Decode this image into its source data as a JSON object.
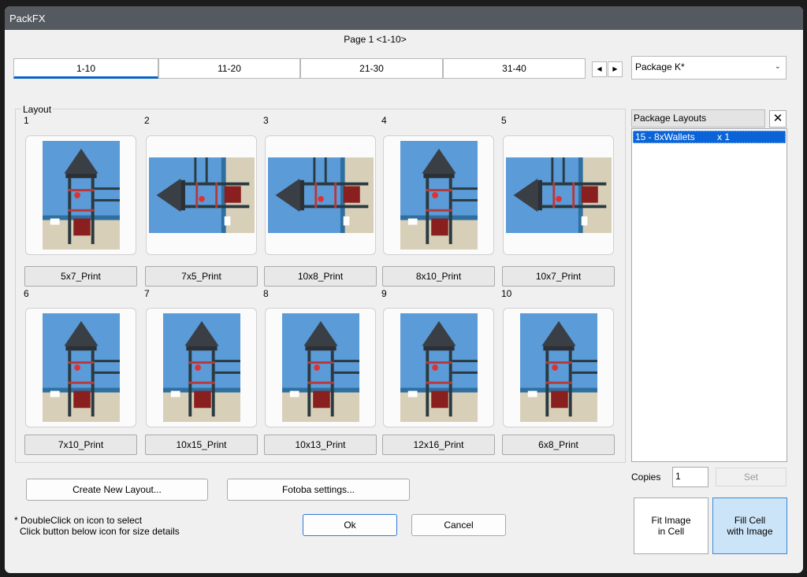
{
  "window": {
    "title": "PackFX"
  },
  "page_label": "Page 1 <1-10>",
  "tabs": [
    {
      "label": "1-10",
      "active": true
    },
    {
      "label": "11-20",
      "active": false
    },
    {
      "label": "21-30",
      "active": false
    },
    {
      "label": "31-40",
      "active": false
    }
  ],
  "package_dropdown": {
    "value": "Package K*"
  },
  "layout_group": {
    "label": "Layout"
  },
  "layouts": [
    {
      "number": "1",
      "size": "5x7_Print",
      "orientation": "portrait"
    },
    {
      "number": "2",
      "size": "7x5_Print",
      "orientation": "landscape"
    },
    {
      "number": "3",
      "size": "10x8_Print",
      "orientation": "landscape"
    },
    {
      "number": "4",
      "size": "8x10_Print",
      "orientation": "portrait"
    },
    {
      "number": "5",
      "size": "10x7_Print",
      "orientation": "landscape"
    },
    {
      "number": "6",
      "size": "7x10_Print",
      "orientation": "portrait"
    },
    {
      "number": "7",
      "size": "10x15_Print",
      "orientation": "portrait"
    },
    {
      "number": "8",
      "size": "10x13_Print",
      "orientation": "portrait"
    },
    {
      "number": "9",
      "size": "12x16_Print",
      "orientation": "portrait"
    },
    {
      "number": "10",
      "size": "6x8_Print",
      "orientation": "portrait"
    }
  ],
  "package_layouts": {
    "header": "Package Layouts",
    "items": [
      {
        "name": "15 - 8xWallets",
        "qty": "x 1",
        "selected": true
      }
    ]
  },
  "copies": {
    "label": "Copies",
    "value": "1",
    "set_label": "Set"
  },
  "buttons": {
    "create_layout": "Create New Layout...",
    "fotoba": "Fotoba settings...",
    "ok": "Ok",
    "cancel": "Cancel",
    "fit_image": "Fit Image\nin Cell",
    "fill_cell": "Fill Cell\nwith Image"
  },
  "hint": {
    "line1": "* DoubleClick on icon to select",
    "line2": "Click button below icon for size details"
  },
  "colors": {
    "accent": "#0a64d8",
    "tab_underline": "#0a64c8",
    "sky": "#5b9bd8",
    "selected_button": "#cce4f7"
  }
}
